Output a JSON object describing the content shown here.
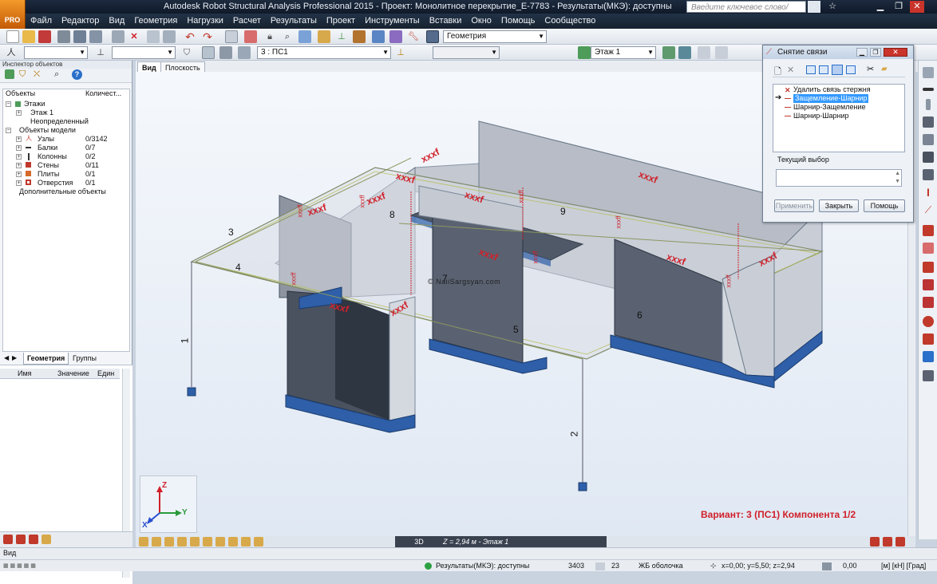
{
  "app": {
    "logo_text": "PRO",
    "title": "Autodesk Robot Structural Analysis Professional 2015 - Проект: Монолитное перекрытие_E-7783 - Результаты(МКЭ): доступны",
    "search_placeholder": "Введите ключевое слово/фразу"
  },
  "menu": [
    "Файл",
    "Редактор",
    "Вид",
    "Геометрия",
    "Нагрузки",
    "Расчет",
    "Результаты",
    "Проект",
    "Инструменты",
    "Вставки",
    "Окно",
    "Помощь",
    "Сообщество"
  ],
  "toolbar": {
    "layout_combo": "Геометрия",
    "case_combo": "3 : ПС1",
    "story_combo": "Этаж 1"
  },
  "inspector": {
    "title": "Инспектор объектов",
    "col_objects": "Объекты",
    "col_count": "Количест...",
    "tree": [
      {
        "label": "Этажи",
        "count": ""
      },
      {
        "label": "Этаж 1",
        "count": ""
      },
      {
        "label": "Неопределенный",
        "count": ""
      },
      {
        "label": "Объекты модели",
        "count": ""
      },
      {
        "label": "Узлы",
        "count": "0/3142"
      },
      {
        "label": "Балки",
        "count": "0/7"
      },
      {
        "label": "Колонны",
        "count": "0/2"
      },
      {
        "label": "Стены",
        "count": "0/11"
      },
      {
        "label": "Плиты",
        "count": "0/1"
      },
      {
        "label": "Отверстия",
        "count": "0/1"
      },
      {
        "label": "Дополнительные объекты",
        "count": ""
      }
    ],
    "tabs": [
      "Геометрия",
      "Группы"
    ],
    "props_cols": [
      "Имя",
      "Значение",
      "Един"
    ]
  },
  "view": {
    "tabs": [
      "Вид",
      "Плоскость"
    ],
    "watermark": "© NaiiSargsyan.com",
    "beam_labels": [
      "1",
      "2",
      "3",
      "4",
      "5",
      "6",
      "7",
      "8",
      "9"
    ],
    "release_label": "xxxf",
    "release_label_v": "xxxff",
    "variant_text": "Вариант: 3 (ПС1) Компонента 1/2",
    "mode_3d": "3D",
    "z_level": "Z = 2,94 м - Этаж 1",
    "axis_x": "X",
    "axis_y": "Y",
    "axis_z": "Z"
  },
  "dialog": {
    "title": "Снятие связи",
    "items": [
      "Удалить связь стержня",
      "Защемление-Шарнир",
      "Шарнир-Защемление",
      "Шарнир-Шарнир"
    ],
    "current_label": "Текущий выбор",
    "apply": "Применить",
    "close": "Закрыть",
    "help": "Помощь"
  },
  "status": {
    "view_label": "Вид",
    "results": "Результаты(МКЭ): доступны",
    "n1": "3403",
    "n2": "23",
    "section": "ЖБ оболочка",
    "coords": "x=0,00; y=5,50; z=2,94",
    "zero1": "0,00",
    "units": "[м] [кН] [Град]"
  },
  "colors": {
    "accent_red": "#d0202a",
    "wall_blue": "#2e5fa8",
    "selection": "#3399ff"
  }
}
